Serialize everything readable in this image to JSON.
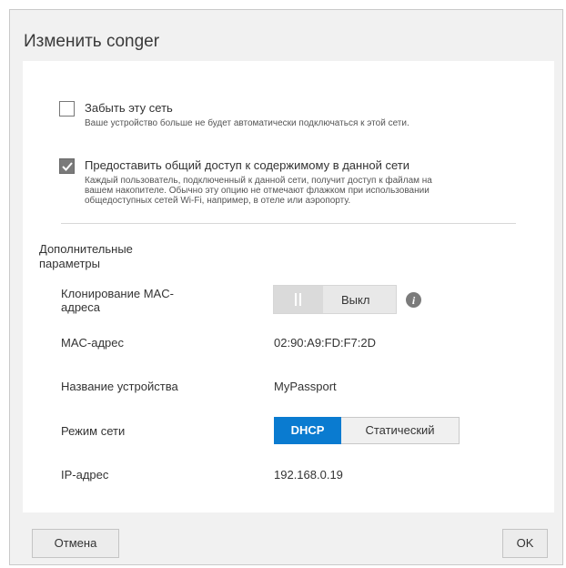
{
  "dialog": {
    "title": "Изменить conger",
    "forget": {
      "checked": false,
      "label": "Забыть эту сеть",
      "description": "Ваше устройство больше не будет автоматически подключаться к этой сети."
    },
    "share": {
      "checked": true,
      "label": "Предоставить общий доступ к содержимому в данной сети",
      "description_lines": [
        "Каждый пользователь, подключенный к данной сети, получит доступ к файлам на",
        "вашем накопителе. Обычно эту опцию не отмечают флажком при использовании",
        "общедоступных сетей Wi-Fi, например, в отеле или аэропорту."
      ]
    },
    "advanced": {
      "title_lines": [
        "Дополнительные",
        "параметры"
      ],
      "mac_clone": {
        "label_lines": [
          "Клонирование MAC-",
          "адреса"
        ],
        "toggle_text": "Выкл",
        "info_icon": "info-icon"
      },
      "mac": {
        "label": "MAC-адрес",
        "value": "02:90:A9:FD:F7:2D"
      },
      "device_name": {
        "label": "Название устройства",
        "value": "MyPassport"
      },
      "net_mode": {
        "label": "Режим сети",
        "options": [
          "DHCP",
          "Статический"
        ],
        "selected": "DHCP"
      },
      "ip": {
        "label": "IP-адрес",
        "value": "192.168.0.19"
      }
    },
    "buttons": {
      "cancel": "Отмена",
      "ok": "OK"
    },
    "colors": {
      "accent": "#0a7bd0",
      "background": "#f1f1f1",
      "panel": "#ffffff"
    }
  }
}
